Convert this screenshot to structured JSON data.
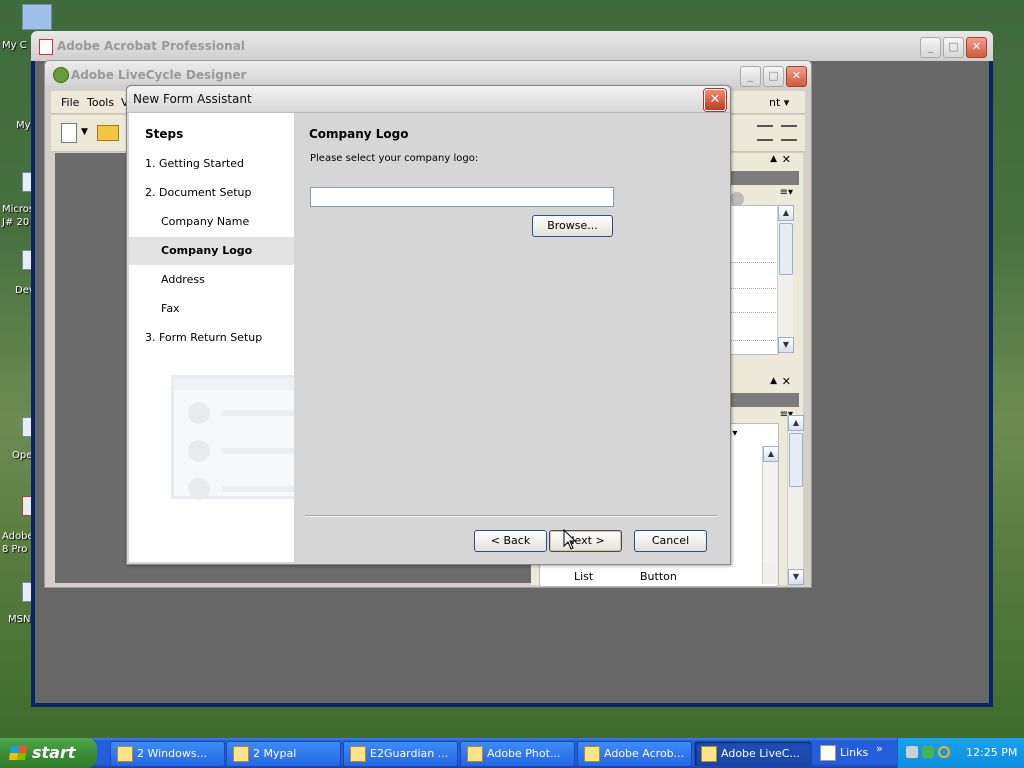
{
  "desktop": {
    "icons": [
      "My C",
      "My",
      "Micros\nJ# 20",
      "Dev",
      "Ope",
      "Adobe\n8 Pro",
      "MSN"
    ]
  },
  "acrobat": {
    "title": "Adobe Acrobat Professional"
  },
  "livecycle": {
    "title": "Adobe LiveCycle Designer",
    "menu": [
      "File",
      "Tools",
      "V"
    ],
    "menu_right": "nt ▾",
    "palette_list": {
      "col1": "List",
      "col2": "Button"
    }
  },
  "dialog": {
    "title": "New Form Assistant",
    "steps_heading": "Steps",
    "steps": [
      {
        "label": "1. Getting Started",
        "indent": false,
        "selected": false
      },
      {
        "label": "2. Document Setup",
        "indent": false,
        "selected": false
      },
      {
        "label": "Company Name",
        "indent": true,
        "selected": false
      },
      {
        "label": "Company Logo",
        "indent": true,
        "selected": true
      },
      {
        "label": "Address",
        "indent": true,
        "selected": false
      },
      {
        "label": "Fax",
        "indent": true,
        "selected": false
      },
      {
        "label": "3. Form Return Setup",
        "indent": false,
        "selected": false
      }
    ],
    "section_title": "Company Logo",
    "prompt": "Please select your company logo:",
    "logo_path_value": "",
    "browse_label": "Browse...",
    "back_label": "< Back",
    "next_label": "Next >",
    "cancel_label": "Cancel"
  },
  "taskbar": {
    "start_label": "start",
    "tasks": [
      {
        "label": "2 Windows...",
        "active": false
      },
      {
        "label": "2 Mypal",
        "active": false
      },
      {
        "label": "E2Guardian ...",
        "active": false
      },
      {
        "label": "Adobe Phot...",
        "active": false
      },
      {
        "label": "Adobe Acrob...",
        "active": false
      },
      {
        "label": "Adobe LiveC...",
        "active": true
      }
    ],
    "links_label": "Links",
    "clock": "12:25 PM"
  }
}
